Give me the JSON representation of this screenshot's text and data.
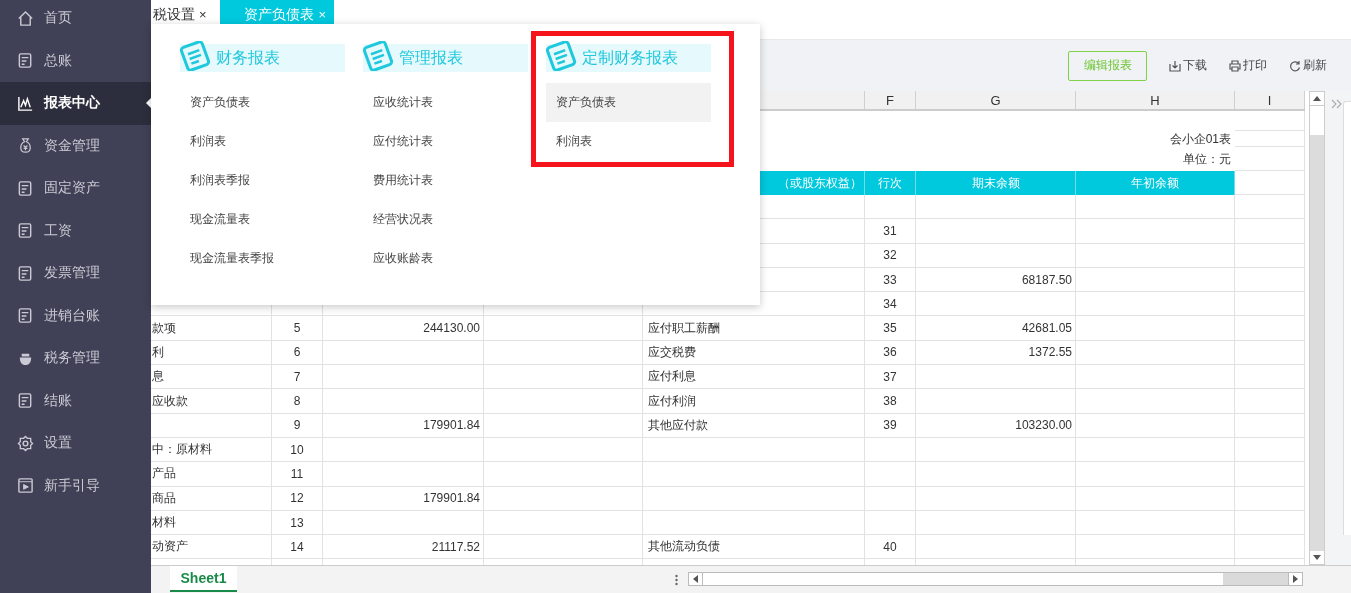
{
  "sidebar": {
    "items": [
      {
        "label": "首页",
        "selected": false
      },
      {
        "label": "总账",
        "selected": false
      },
      {
        "label": "报表中心",
        "selected": true
      },
      {
        "label": "资金管理",
        "selected": false
      },
      {
        "label": "固定资产",
        "selected": false
      },
      {
        "label": "工资",
        "selected": false
      },
      {
        "label": "发票管理",
        "selected": false
      },
      {
        "label": "进销台账",
        "selected": false
      },
      {
        "label": "税务管理",
        "selected": false
      },
      {
        "label": "结账",
        "selected": false
      },
      {
        "label": "设置",
        "selected": false
      },
      {
        "label": "新手引导",
        "selected": false
      }
    ]
  },
  "tabs": [
    {
      "label": "税设置",
      "close": "×",
      "selected": false
    },
    {
      "label": "资产负债表",
      "close": "×",
      "selected": true
    }
  ],
  "toolbar": {
    "buttons": [
      {
        "label": "编辑报表",
        "kind": "primary"
      },
      {
        "label": "下载",
        "kind": "download"
      },
      {
        "label": "打印",
        "kind": "print"
      },
      {
        "label": "刷新",
        "kind": "refresh"
      }
    ]
  },
  "sheet": {
    "column_headers": [
      "F",
      "G",
      "H",
      "I"
    ],
    "form_code": "会小企01表",
    "unit": "单位：元",
    "header_cells": [
      "（或股东权益）",
      "行次",
      "期末余额",
      "年初余额"
    ],
    "rows": [
      {
        "liability_line": "31"
      },
      {
        "liability_line": "32"
      },
      {
        "liability_line": "33",
        "closing": "68187.50"
      },
      {
        "liability_line": "34"
      },
      {
        "item": "款项",
        "line": "5",
        "amount": "244130.00",
        "liability": "应付职工薪酬",
        "liability_line": "35",
        "closing": "42681.05"
      },
      {
        "item": "利",
        "line": "6",
        "liability": "应交税费",
        "liability_line": "36",
        "closing": "1372.55"
      },
      {
        "item": "息",
        "line": "7",
        "liability": "应付利息",
        "liability_line": "37"
      },
      {
        "item": "应收款",
        "line": "8",
        "liability": "应付利润",
        "liability_line": "38"
      },
      {
        "line": "9",
        "amount": "179901.84",
        "liability": "其他应付款",
        "liability_line": "39",
        "closing": "103230.00"
      },
      {
        "item": "中：原材料",
        "line": "10"
      },
      {
        "item": "产品",
        "line": "11"
      },
      {
        "item": "商品",
        "line": "12",
        "amount": "179901.84"
      },
      {
        "item": "材料",
        "line": "13"
      },
      {
        "item": "动资产",
        "line": "14",
        "amount": "21117.52",
        "liability": "其他流动负债",
        "liability_line": "40"
      }
    ]
  },
  "sheet_tabs": [
    {
      "label": "Sheet1",
      "selected": true
    }
  ],
  "report_menu": {
    "groups": [
      {
        "title": "财务报表",
        "highlighted": false,
        "items": [
          {
            "label": "资产负债表",
            "selected": false
          },
          {
            "label": "利润表",
            "selected": false
          },
          {
            "label": "利润表季报",
            "selected": false
          },
          {
            "label": "现金流量表",
            "selected": false
          },
          {
            "label": "现金流量表季报",
            "selected": false
          }
        ]
      },
      {
        "title": "管理报表",
        "highlighted": false,
        "items": [
          {
            "label": "应收统计表",
            "selected": false
          },
          {
            "label": "应付统计表",
            "selected": false
          },
          {
            "label": "费用统计表",
            "selected": false
          },
          {
            "label": "经营状况表",
            "selected": false
          },
          {
            "label": "应收账龄表",
            "selected": false
          }
        ]
      },
      {
        "title": "定制财务报表",
        "highlighted": true,
        "items": [
          {
            "label": "资产负债表",
            "selected": true
          },
          {
            "label": "利润表",
            "selected": false
          }
        ]
      }
    ]
  }
}
